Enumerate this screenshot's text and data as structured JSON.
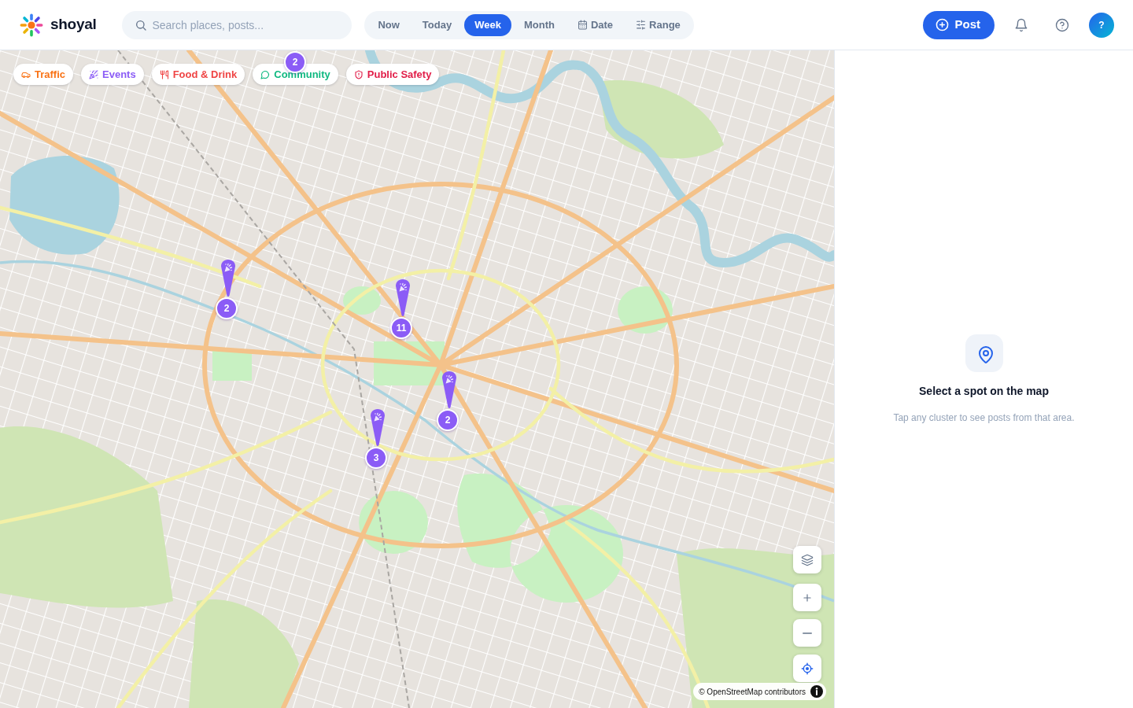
{
  "header": {
    "logo": "shoyal",
    "search": {
      "placeholder": "Search places, posts..."
    },
    "periods": [
      {
        "label": "Now",
        "kind": "preset",
        "selected": false
      },
      {
        "label": "Today",
        "kind": "preset",
        "selected": false
      },
      {
        "label": "Week",
        "kind": "preset",
        "selected": true
      },
      {
        "label": "Month",
        "kind": "preset",
        "selected": false
      },
      {
        "label": "Date",
        "kind": "date",
        "selected": false
      },
      {
        "label": "Range",
        "kind": "range",
        "selected": false
      }
    ],
    "post_button": "Post",
    "avatar": "?"
  },
  "map": {
    "filters": [
      {
        "label": "Traffic",
        "kind": "traffic",
        "color": "#f97316"
      },
      {
        "label": "Events",
        "kind": "events",
        "color": "#8b5cf6"
      },
      {
        "label": "Food & Drink",
        "kind": "food",
        "color": "#ef4444"
      },
      {
        "label": "Community",
        "kind": "community",
        "color": "#10b981"
      },
      {
        "label": "Public Safety",
        "kind": "safety",
        "color": "#e11d48"
      }
    ],
    "clusters": [
      {
        "count": "2"
      },
      {
        "count": "2",
        "kind": "events"
      },
      {
        "count": "11",
        "kind": "events"
      },
      {
        "count": "2",
        "kind": "events"
      },
      {
        "count": "3",
        "kind": "events"
      }
    ],
    "attribution": "© OpenStreetMap contributors"
  },
  "panel": {
    "title": "Select a spot on the map",
    "hint": "Tap any cluster to see posts from that area."
  }
}
